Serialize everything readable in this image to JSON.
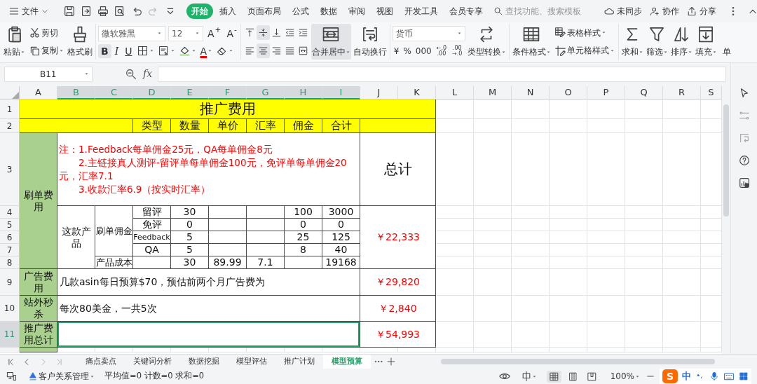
{
  "menu": {
    "file": "文件",
    "tabs": [
      {
        "label": "开始",
        "selected": true
      },
      {
        "label": "插入",
        "selected": false
      },
      {
        "label": "页面布局",
        "selected": false
      },
      {
        "label": "公式",
        "selected": false
      },
      {
        "label": "数据",
        "selected": false
      },
      {
        "label": "审阅",
        "selected": false
      },
      {
        "label": "视图",
        "selected": false
      },
      {
        "label": "开发工具",
        "selected": false
      },
      {
        "label": "会员专享",
        "selected": false
      }
    ],
    "search": {
      "placeholder": "查找功能、搜索模板"
    },
    "actions": [
      {
        "label": "未同步",
        "kind": "sync"
      },
      {
        "label": "协作",
        "kind": "collab"
      },
      {
        "label": "分享",
        "kind": "share"
      }
    ]
  },
  "ribbon": {
    "clipboard": {
      "paste": "粘贴",
      "cut": "剪切",
      "copy": "复制",
      "format_painter": "格式刷"
    },
    "font": {
      "name": "微软雅黑",
      "size": "12",
      "grow": "A$^{+}$",
      "shrink": "A$^{-}$",
      "font_color": "A",
      "styles": [
        {
          "label": "B",
          "kind": "bold",
          "selected": true
        },
        {
          "label": "I",
          "kind": "italic",
          "selected": false
        },
        {
          "label": "U",
          "kind": "underline",
          "selected": false
        }
      ]
    },
    "align_buttons": [
      {
        "kind": "top",
        "selected": false
      },
      {
        "kind": "middle",
        "selected": true
      },
      {
        "kind": "bottom",
        "selected": false
      },
      {
        "kind": "outdent",
        "selected": false
      },
      {
        "kind": "indent",
        "selected": false
      },
      {
        "kind": "left",
        "selected": false
      },
      {
        "kind": "center",
        "selected": true
      },
      {
        "kind": "right",
        "selected": false
      },
      {
        "kind": "justify",
        "selected": false
      },
      {
        "kind": "distributed",
        "selected": false
      }
    ],
    "merge": {
      "label": "合并居中",
      "selected": true
    },
    "wrap": "自动换行",
    "number": {
      "format": "货币",
      "buttons": [
        "¥",
        "%",
        "000"
      ],
      "decimals": [
        {
          "top": "←.0",
          "bottom": ".00"
        },
        {
          "top": ".00",
          "bottom": "→.0"
        }
      ],
      "convert": "类型转换"
    },
    "styles": {
      "conditional": "条件格式",
      "table_style": "表格样式",
      "cell_style": "单元格样式"
    },
    "editing": [
      {
        "label": "求和",
        "kind": "sum"
      },
      {
        "label": "筛选",
        "kind": "filter"
      },
      {
        "label": "排序",
        "kind": "sort"
      },
      {
        "label": "填充",
        "kind": "fill"
      },
      {
        "label": "单",
        "kind": "cut"
      }
    ]
  },
  "formula_bar": {
    "name_box": "B11",
    "fx": "fx"
  },
  "sheet": {
    "columns": [
      {
        "label": "A",
        "selected": false
      },
      {
        "label": "B",
        "selected": true
      },
      {
        "label": "C",
        "selected": true
      },
      {
        "label": "D",
        "selected": true
      },
      {
        "label": "E",
        "selected": true
      },
      {
        "label": "F",
        "selected": true
      },
      {
        "label": "G",
        "selected": true
      },
      {
        "label": "H",
        "selected": true
      },
      {
        "label": "I",
        "selected": true
      },
      {
        "label": "J",
        "selected": false
      },
      {
        "label": "K",
        "selected": false
      },
      {
        "label": "L",
        "selected": false
      },
      {
        "label": "M",
        "selected": false
      },
      {
        "label": "N",
        "selected": false
      },
      {
        "label": "O",
        "selected": false
      },
      {
        "label": "P",
        "selected": false
      },
      {
        "label": "Q",
        "selected": false
      },
      {
        "label": "R",
        "selected": false
      },
      {
        "label": "S",
        "selected": false
      }
    ],
    "rows": [
      {
        "label": "1",
        "selected": false
      },
      {
        "label": "2",
        "selected": false
      },
      {
        "label": "3",
        "selected": false
      },
      {
        "label": "4",
        "selected": false
      },
      {
        "label": "5",
        "selected": false
      },
      {
        "label": "6",
        "selected": false
      },
      {
        "label": "7",
        "selected": false
      },
      {
        "label": "8",
        "selected": false
      },
      {
        "label": "9",
        "selected": false
      },
      {
        "label": "10",
        "selected": false
      },
      {
        "label": "11",
        "selected": true
      }
    ],
    "cells": [
      {
        "kind": "title",
        "text": "推广费用"
      },
      {
        "kind": "header"
      },
      {
        "kind": "header",
        "text": "类型"
      },
      {
        "kind": "header",
        "text": "数量"
      },
      {
        "kind": "header",
        "text": "单价"
      },
      {
        "kind": "header",
        "text": "汇率"
      },
      {
        "kind": "header",
        "text": "佣金"
      },
      {
        "kind": "header",
        "text": "合计"
      },
      {
        "kind": "header"
      },
      {
        "kind": "category",
        "text": "刷单费用"
      },
      {
        "kind": "note",
        "lines": [
          "注：1.Feedback每单佣金25元，QA每单佣金8元",
          "2.主链接真人测评-留评单每单佣金100元，免评单每单佣金20元，汇率7.1",
          "3.收款汇率6.9（按实时汇率）"
        ]
      },
      {
        "kind": "big",
        "text": "总计"
      },
      {
        "kind": "text",
        "text": "这款产品"
      },
      {
        "kind": "compact",
        "text": "刷单佣金"
      },
      {
        "kind": "text",
        "text": "留评"
      },
      {
        "kind": "text",
        "text": "30"
      },
      {
        "kind": "text"
      },
      {
        "kind": "text"
      },
      {
        "kind": "text",
        "text": "100"
      },
      {
        "kind": "text",
        "text": "3000"
      },
      {
        "kind": "text",
        "text": "免评"
      },
      {
        "kind": "text",
        "text": "0"
      },
      {
        "kind": "text"
      },
      {
        "kind": "text"
      },
      {
        "kind": "text",
        "text": "0"
      },
      {
        "kind": "text",
        "text": "0"
      },
      {
        "kind": "small",
        "text": "Feedback"
      },
      {
        "kind": "text",
        "text": "5"
      },
      {
        "kind": "text"
      },
      {
        "kind": "text"
      },
      {
        "kind": "text",
        "text": "25"
      },
      {
        "kind": "text",
        "text": "125"
      },
      {
        "kind": "text",
        "text": "QA"
      },
      {
        "kind": "text",
        "text": "5"
      },
      {
        "kind": "text"
      },
      {
        "kind": "text"
      },
      {
        "kind": "text",
        "text": "8"
      },
      {
        "kind": "text",
        "text": "40"
      },
      {
        "kind": "compact",
        "text": "产品成本"
      },
      {
        "kind": "text"
      },
      {
        "kind": "text",
        "text": "30"
      },
      {
        "kind": "text",
        "text": "89.99"
      },
      {
        "kind": "text",
        "text": "7.1"
      },
      {
        "kind": "text"
      },
      {
        "kind": "text",
        "text": "19168"
      },
      {
        "kind": "money",
        "text": "￥22,333"
      },
      {
        "kind": "category",
        "text": "广告费用"
      },
      {
        "kind": "left",
        "text": "几款asin每日预算$70，预估前两个月广告费为"
      },
      {
        "kind": "money",
        "text": "￥29,820"
      },
      {
        "kind": "category",
        "text": "站外秒杀"
      },
      {
        "kind": "left",
        "text": "每次80美金，一共5次"
      },
      {
        "kind": "money",
        "text": "￥2,840"
      },
      {
        "kind": "category",
        "text": "推广费用总计"
      },
      {
        "kind": "left",
        "selected": true
      },
      {
        "kind": "money",
        "text": "￥54,993"
      },
      {
        "kind": "category"
      }
    ]
  },
  "sheet_tabs": [
    {
      "label": "痛点卖点",
      "selected": false
    },
    {
      "label": "关键词分析",
      "selected": false
    },
    {
      "label": "数据挖掘",
      "selected": false
    },
    {
      "label": "模型评估",
      "selected": false
    },
    {
      "label": "推广计划",
      "selected": false
    },
    {
      "label": "模型预算",
      "selected": true
    }
  ],
  "status_bar": {
    "crm": "客户关系管理",
    "stats": "平均值=0 计数=0 求和=0",
    "zoom": "100%",
    "views": [
      {
        "kind": "normal",
        "selected": true
      },
      {
        "kind": "page",
        "selected": false
      },
      {
        "kind": "break",
        "selected": false
      }
    ]
  },
  "ime": {
    "logo": "S",
    "mode": "中"
  }
}
